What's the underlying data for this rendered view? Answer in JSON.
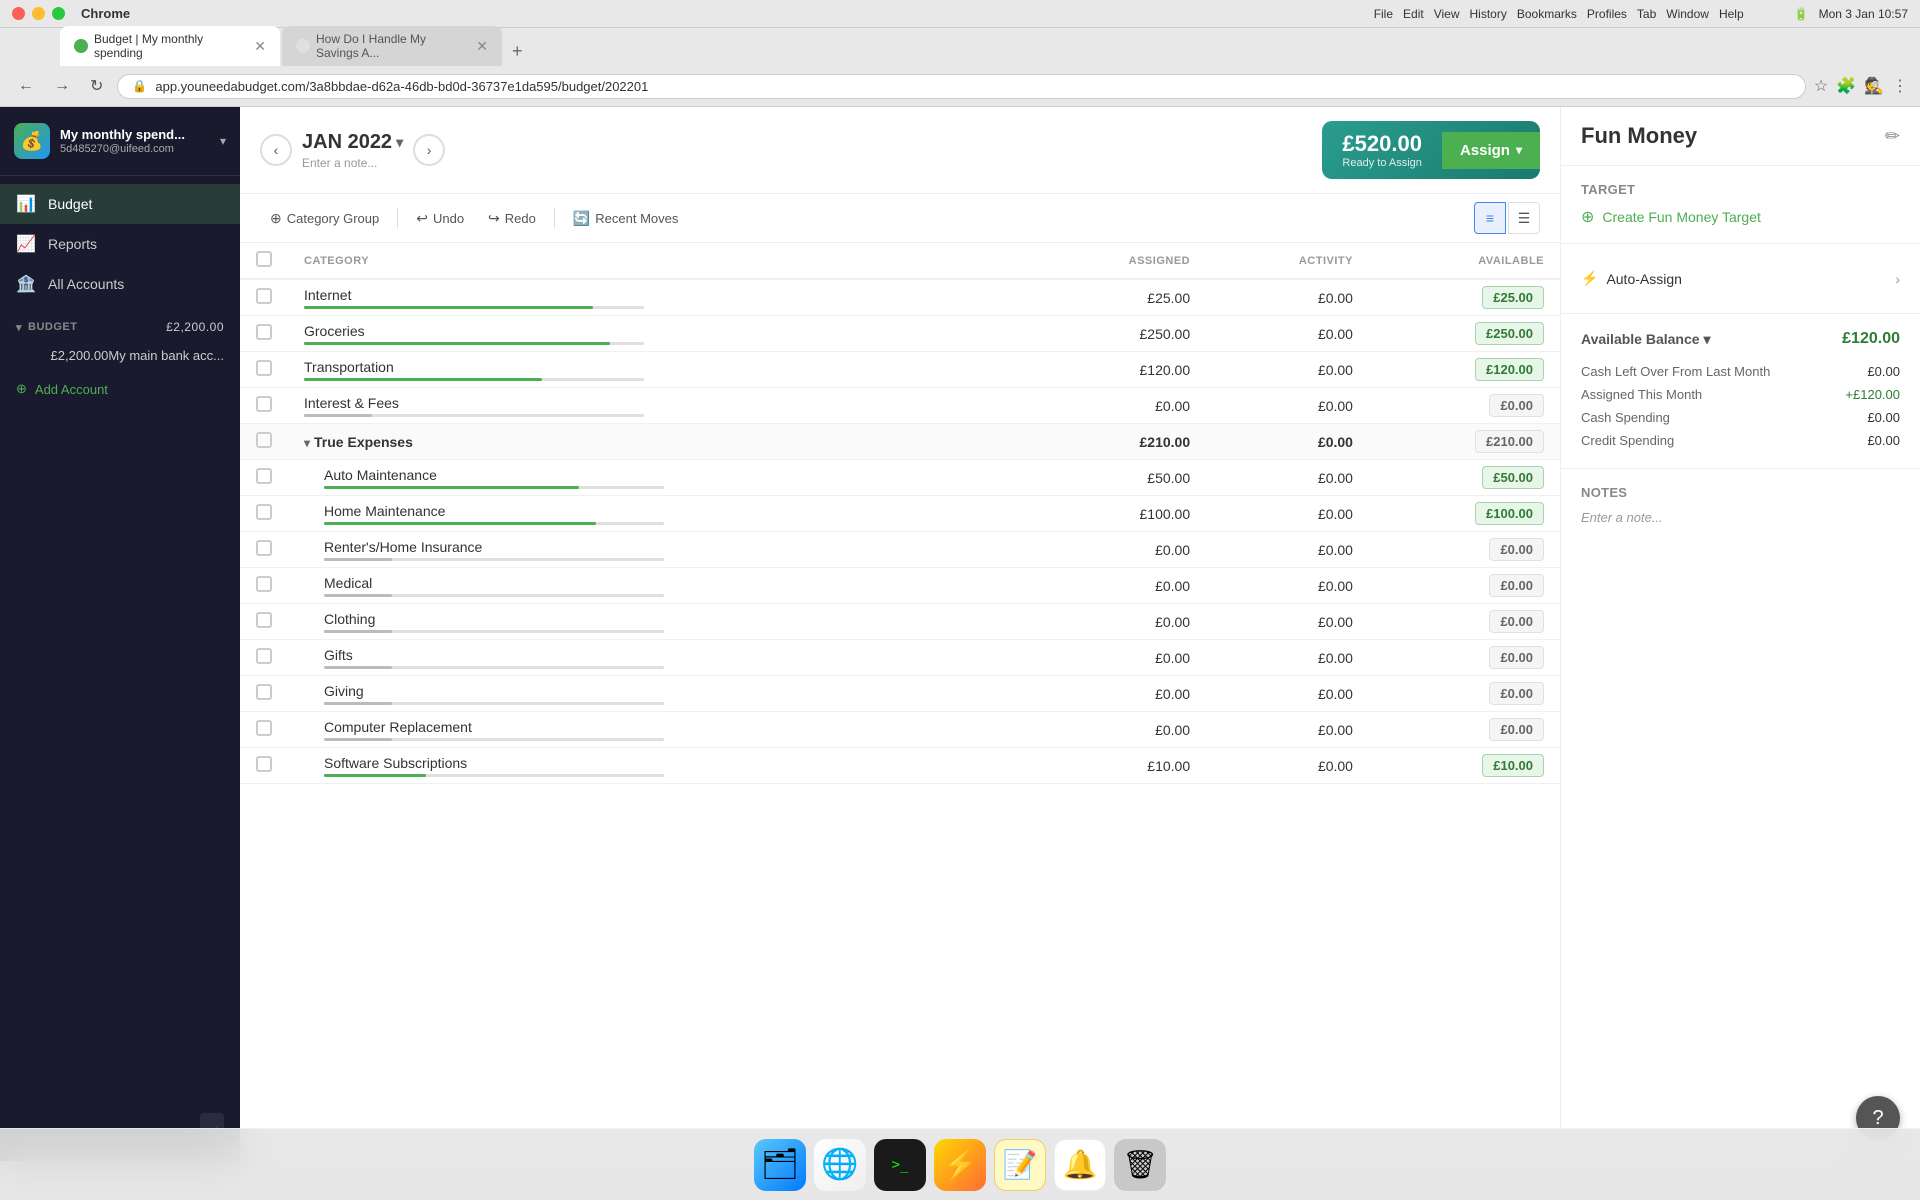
{
  "titlebar": {
    "app_name": "Chrome",
    "date_time": "Mon 3 Jan  10:57"
  },
  "tabs": [
    {
      "id": "tab1",
      "label": "Budget | My monthly spending",
      "active": true
    },
    {
      "id": "tab2",
      "label": "How Do I Handle My Savings A...",
      "active": false
    }
  ],
  "address_bar": {
    "url": "app.youneedabudget.com/3a8bbdae-d62a-46db-bd0d-36737e1da595/budget/202201"
  },
  "sidebar": {
    "account_name": "My monthly spend...",
    "account_id": "5d485270@uifeed.com",
    "nav_items": [
      {
        "id": "budget",
        "label": "Budget",
        "active": true
      },
      {
        "id": "reports",
        "label": "Reports",
        "active": false
      },
      {
        "id": "all_accounts",
        "label": "All Accounts",
        "active": false
      }
    ],
    "budget_section": {
      "label": "BUDGET",
      "amount": "£2,200.00",
      "accounts": [
        {
          "name": "My main bank acc...",
          "amount": "£2,200.00"
        }
      ]
    },
    "add_account_label": "Add Account"
  },
  "budget_header": {
    "month": "JAN 2022",
    "note_placeholder": "Enter a note...",
    "ready_to_assign_amount": "£520.00",
    "ready_to_assign_label": "Ready to Assign",
    "assign_btn_label": "Assign"
  },
  "toolbar": {
    "category_group_label": "Category Group",
    "undo_label": "Undo",
    "redo_label": "Redo",
    "recent_moves_label": "Recent Moves"
  },
  "table_headers": {
    "category": "CATEGORY",
    "assigned": "ASSIGNED",
    "activity": "ACTIVITY",
    "available": "AVAILABLE"
  },
  "categories": [
    {
      "id": "internet",
      "name": "Internet",
      "assigned": "£25.00",
      "activity": "£0.00",
      "available": "£25.00",
      "available_style": "green",
      "bar_pct": 85,
      "bar_style": "green",
      "is_group": false,
      "indent": false
    },
    {
      "id": "groceries",
      "name": "Groceries",
      "assigned": "£250.00",
      "activity": "£0.00",
      "available": "£250.00",
      "available_style": "green",
      "bar_pct": 90,
      "bar_style": "green",
      "is_group": false,
      "indent": false
    },
    {
      "id": "transportation",
      "name": "Transportation",
      "assigned": "£120.00",
      "activity": "£0.00",
      "available": "£120.00",
      "available_style": "green",
      "bar_pct": 70,
      "bar_style": "green",
      "is_group": false,
      "indent": false
    },
    {
      "id": "interest_fees",
      "name": "Interest & Fees",
      "assigned": "£0.00",
      "activity": "£0.00",
      "available": "£0.00",
      "available_style": "neutral",
      "bar_pct": 20,
      "bar_style": "gray",
      "is_group": false,
      "indent": false
    },
    {
      "id": "true_expenses_group",
      "name": "True Expenses",
      "assigned": "£210.00",
      "activity": "£0.00",
      "available": "£210.00",
      "available_style": "neutral",
      "bar_pct": 0,
      "bar_style": "gray",
      "is_group": true,
      "indent": false
    },
    {
      "id": "auto_maintenance",
      "name": "Auto Maintenance",
      "assigned": "£50.00",
      "activity": "£0.00",
      "available": "£50.00",
      "available_style": "green",
      "bar_pct": 75,
      "bar_style": "green",
      "is_group": false,
      "indent": true
    },
    {
      "id": "home_maintenance",
      "name": "Home Maintenance",
      "assigned": "£100.00",
      "activity": "£0.00",
      "available": "£100.00",
      "available_style": "green",
      "bar_pct": 80,
      "bar_style": "green",
      "is_group": false,
      "indent": true
    },
    {
      "id": "renters_insurance",
      "name": "Renter's/Home Insurance",
      "assigned": "£0.00",
      "activity": "£0.00",
      "available": "£0.00",
      "available_style": "neutral",
      "bar_pct": 20,
      "bar_style": "gray",
      "is_group": false,
      "indent": true
    },
    {
      "id": "medical",
      "name": "Medical",
      "assigned": "£0.00",
      "activity": "£0.00",
      "available": "£0.00",
      "available_style": "neutral",
      "bar_pct": 20,
      "bar_style": "gray",
      "is_group": false,
      "indent": true
    },
    {
      "id": "clothing",
      "name": "Clothing",
      "assigned": "£0.00",
      "activity": "£0.00",
      "available": "£0.00",
      "available_style": "neutral",
      "bar_pct": 20,
      "bar_style": "gray",
      "is_group": false,
      "indent": true
    },
    {
      "id": "gifts",
      "name": "Gifts",
      "assigned": "£0.00",
      "activity": "£0.00",
      "available": "£0.00",
      "available_style": "neutral",
      "bar_pct": 20,
      "bar_style": "gray",
      "is_group": false,
      "indent": true
    },
    {
      "id": "giving",
      "name": "Giving",
      "assigned": "£0.00",
      "activity": "£0.00",
      "available": "£0.00",
      "available_style": "neutral",
      "bar_pct": 20,
      "bar_style": "gray",
      "is_group": false,
      "indent": true
    },
    {
      "id": "computer_replacement",
      "name": "Computer Replacement",
      "assigned": "£0.00",
      "activity": "£0.00",
      "available": "£0.00",
      "available_style": "neutral",
      "bar_pct": 20,
      "bar_style": "gray",
      "is_group": false,
      "indent": true
    },
    {
      "id": "software_subscriptions",
      "name": "Software Subscriptions",
      "assigned": "£10.00",
      "activity": "£0.00",
      "available": "£10.00",
      "available_style": "green",
      "bar_pct": 30,
      "bar_style": "green",
      "is_group": false,
      "indent": true
    }
  ],
  "right_panel": {
    "title": "Fun Money",
    "target_section_label": "Target",
    "create_target_label": "Create Fun Money Target",
    "auto_assign_label": "Auto-Assign",
    "available_balance_label": "Available Balance",
    "available_balance_amount": "£120.00",
    "balance_details": [
      {
        "label": "Cash Left Over From Last Month",
        "value": "£0.00",
        "positive": false
      },
      {
        "label": "Assigned This Month",
        "value": "+£120.00",
        "positive": true
      },
      {
        "label": "Cash Spending",
        "value": "£0.00",
        "positive": false
      },
      {
        "label": "Credit Spending",
        "value": "£0.00",
        "positive": false
      }
    ],
    "notes_label": "Notes",
    "notes_placeholder": "Enter a note..."
  },
  "dock": {
    "items": [
      {
        "id": "finder",
        "label": "Finder",
        "emoji": "🔍"
      },
      {
        "id": "chrome",
        "label": "Chrome",
        "emoji": "🌐"
      },
      {
        "id": "terminal",
        "label": "Terminal",
        "text": ">_"
      },
      {
        "id": "spark",
        "label": "Spark",
        "emoji": "⚡"
      },
      {
        "id": "notes",
        "label": "Notes",
        "emoji": "📝"
      },
      {
        "id": "reminders",
        "label": "Reminders",
        "emoji": "🔔"
      },
      {
        "id": "trash",
        "label": "Trash",
        "emoji": "🗑️"
      }
    ]
  },
  "colors": {
    "sidebar_bg": "#1a1a2e",
    "accent_green": "#4CAF50",
    "teal": "#2a9d8f",
    "available_green_bg": "#e8f5e9",
    "available_green_text": "#2e7d32"
  }
}
